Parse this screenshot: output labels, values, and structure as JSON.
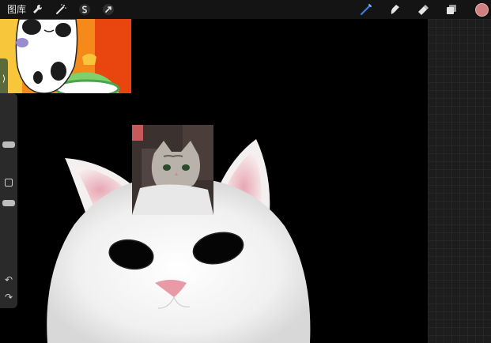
{
  "toolbar": {
    "gallery_label": "图库",
    "left_tools": [
      "wrench-icon",
      "magic-wand-icon",
      "selection-icon",
      "transform-icon"
    ],
    "right_tools": [
      "brush-icon",
      "smudge-icon",
      "eraser-icon",
      "layers-icon"
    ],
    "current_color": "#d08080",
    "brush_active_color": "#3d7fe0"
  },
  "sidebar": {
    "brush_size_level": 0.3,
    "opacity_level": 0.45,
    "undo_glyph": "↶",
    "redo_glyph": "↷"
  },
  "reference": {
    "tab_glyph": "⟩"
  }
}
